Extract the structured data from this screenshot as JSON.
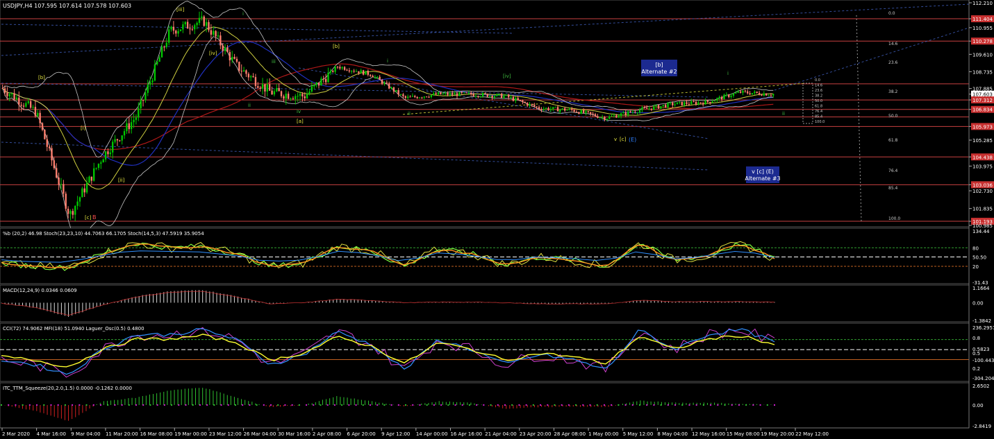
{
  "header": {
    "symbol_line": "USDJPY,H4  107.595 107.614 107.578 107.603"
  },
  "panes": {
    "stoch": {
      "title": "%b (20,2) 46.98  Stoch(23,23,10) 44.7063 66.1705  Stoch(14,5,3) 47.5919 35.9054",
      "axis": [
        "134.44",
        "80",
        "50.50",
        "20",
        "-31.43"
      ]
    },
    "macd": {
      "title": "MACD(12,24,9) 0.0346 0.0609",
      "axis": [
        "1.1664",
        "0.00",
        "-1.3842"
      ]
    },
    "cci": {
      "title": "CCI(72) 74.9062  MFI(18) 51.0940  Laguer_Osc(0.5) 0.4800",
      "axis": [
        "236.2957",
        "0.8",
        "0.5",
        "0.5823",
        "-100.4431",
        "0.2",
        "-304.204"
      ]
    },
    "squeeze": {
      "title": "ITC_TTM_Squeeze(20,2.0,1.5) 0.0000 -0.1262 0.0000",
      "axis": [
        "2.6502",
        "0.00",
        "-2.8419"
      ]
    }
  },
  "price_axis": [
    "112.210",
    "111.404",
    "110.955",
    "110.278",
    "109.610",
    "108.735",
    "107.885",
    "107.603",
    "107.312",
    "106.834",
    "105.973",
    "105.285",
    "104.438",
    "103.975",
    "103.036",
    "102.730",
    "101.835",
    "101.193",
    "100.985"
  ],
  "highlighted_levels": [
    "111.404",
    "110.278",
    "108.122",
    "107.312",
    "106.834",
    "106.453",
    "105.973",
    "104.438",
    "103.036",
    "101.193"
  ],
  "current_price": "107.603",
  "time_axis": [
    "2 Mar 2020",
    "4 Mar 16:00",
    "9 Mar 04:00",
    "11 Mar 20:00",
    "16 Mar 08:00",
    "19 Mar 00:00",
    "23 Mar 12:00",
    "26 Mar 04:00",
    "30 Mar 16:00",
    "2 Apr 08:00",
    "6 Apr 20:00",
    "9 Apr 12:00",
    "14 Apr 00:00",
    "16 Apr 16:00",
    "21 Apr 04:00",
    "23 Apr 20:00",
    "28 Apr 08:00",
    "1 May 00:00",
    "5 May 12:00",
    "8 May 04:00",
    "12 May 16:00",
    "15 May 08:00",
    "19 May 20:00",
    "22 May 12:00"
  ],
  "fib_levels": [
    "0.0",
    "14.6",
    "23.6",
    "38.2",
    "50.0",
    "61.8",
    "76.4",
    "85.4",
    "100.0"
  ],
  "fib_small": [
    "0.0",
    "14.6",
    "23.6",
    "38.2",
    "50.0",
    "61.8",
    "76.4",
    "85.4",
    "100.0"
  ],
  "wave_labels": {
    "iii": "[iii]",
    "iv": "[iv]",
    "b": "[b]",
    "a": "[a]",
    "ii_a": "ii",
    "ii_b": "ii",
    "iii_b": "iii",
    "iv_b": "iv",
    "i_a": "i",
    "i_b": "i",
    "ii_c": "ii",
    "ii_d": "ii",
    "i_c": "i",
    "i_d": "i",
    "ii_e": "ii",
    "b_left": "[b]",
    "i_left": "[i]",
    "ii_left": "[ii]",
    "c_low": "[c]",
    "B": "B",
    "iv_small": "[iv]",
    "alt2_line1": "[b]",
    "alt2_line2": "Alternate #2",
    "alt3_line1": "v   [c] (E)",
    "alt3_line2": "Alternate #3",
    "vcE_v": "v",
    "vcE_c": "[c]",
    "vcE_E": "(E)"
  },
  "colors": {
    "bg": "#000000",
    "up_candle": "#00c800",
    "down_candle": "#ff7f6e",
    "level_line": "#c84040",
    "grid_dash": "#4060c0",
    "wave_yellow": "#e8e840",
    "wave_green": "#40c040",
    "label_box": "#1c2a90"
  },
  "chart_data": [
    {
      "type": "line",
      "title": "USDJPY,H4",
      "x": [
        "2 Mar 2020",
        "4 Mar 16:00",
        "9 Mar 04:00",
        "11 Mar 20:00",
        "16 Mar 08:00",
        "19 Mar 00:00",
        "23 Mar 12:00",
        "26 Mar 04:00",
        "30 Mar 16:00",
        "2 Apr 08:00",
        "6 Apr 20:00",
        "9 Apr 12:00",
        "14 Apr 00:00",
        "16 Apr 16:00",
        "21 Apr 04:00",
        "23 Apr 20:00",
        "28 Apr 08:00",
        "1 May 00:00",
        "5 May 12:00",
        "8 May 04:00",
        "12 May 16:00",
        "15 May 08:00",
        "19 May 20:00",
        "22 May 12:00"
      ],
      "series": [
        {
          "values": [
            107.9,
            106.7,
            101.5,
            104.5,
            106.5,
            110.8,
            111.3,
            109.0,
            107.7,
            107.5,
            109.0,
            108.6,
            107.4,
            107.6,
            107.6,
            107.5,
            106.9,
            106.8,
            106.4,
            106.8,
            107.1,
            107.2,
            107.7,
            107.6
          ]
        }
      ],
      "ylim": [
        100.985,
        112.21
      ]
    },
    {
      "type": "line",
      "title": "Stochastic",
      "series": [
        {
          "values": [
            30,
            20,
            15,
            60,
            95,
            80,
            85,
            60,
            20,
            30,
            85,
            70,
            20,
            75,
            60,
            25,
            50,
            40,
            20,
            95,
            40,
            55,
            95,
            45
          ]
        }
      ],
      "ylim": [
        -31.43,
        134.44
      ]
    },
    {
      "type": "bar",
      "title": "MACD(12,24,9)",
      "values": [
        -0.05,
        -0.4,
        -1.1,
        -0.2,
        0.5,
        0.9,
        1.0,
        0.5,
        -0.1,
        0.0,
        0.3,
        0.2,
        0.0,
        0.05,
        0.05,
        0.0,
        -0.1,
        -0.1,
        -0.1,
        0.2,
        0.1,
        0.1,
        0.1,
        0.05
      ],
      "ylim": [
        -1.3842,
        1.1664
      ]
    },
    {
      "type": "line",
      "title": "CCI / MFI / Laguerre",
      "series": [
        {
          "values": [
            -100,
            -150,
            -250,
            0,
            150,
            150,
            200,
            100,
            -150,
            -50,
            180,
            50,
            -200,
            100,
            0,
            -150,
            -50,
            -100,
            -200,
            200,
            0,
            150,
            200,
            75
          ]
        }
      ],
      "ylim": [
        -304.204,
        236.2957
      ]
    },
    {
      "type": "bar",
      "title": "ITC_TTM_Squeeze(20,2.0,1.5)",
      "values": [
        0.0,
        -0.8,
        -2.2,
        0.5,
        1.0,
        2.0,
        2.4,
        1.0,
        -0.3,
        0.0,
        1.2,
        0.5,
        -0.2,
        0.5,
        0.3,
        -0.5,
        -0.3,
        -0.2,
        -0.3,
        0.6,
        0.3,
        0.3,
        0.2,
        0.0
      ],
      "ylim": [
        -2.8419,
        2.6502
      ]
    }
  ]
}
